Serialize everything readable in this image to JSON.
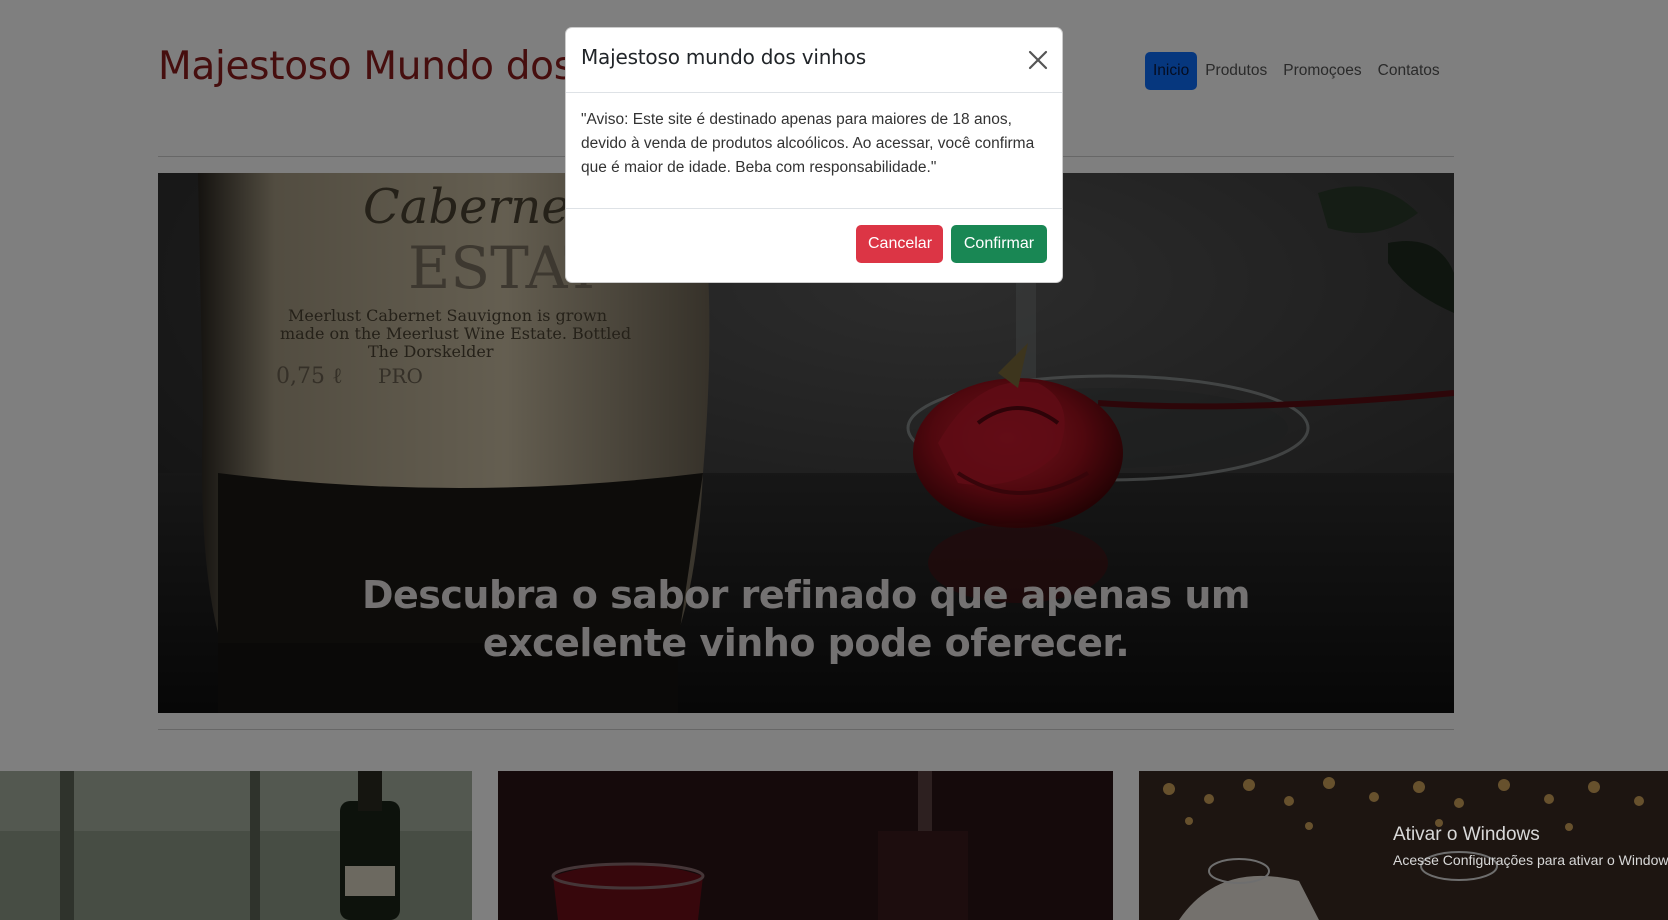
{
  "site": {
    "title": "Majestoso Mundo dos",
    "nav": [
      {
        "label": "Inicio",
        "active": true
      },
      {
        "label": "Produtos",
        "active": false
      },
      {
        "label": "Promoçoes",
        "active": false
      },
      {
        "label": "Contatos",
        "active": false
      }
    ]
  },
  "hero": {
    "caption_line1": "Descubra o sabor refinado que apenas um",
    "caption_line2": "excelente vinho pode oferecer.",
    "label_texts": [
      "Cabernet",
      "ESTAT",
      "Meerlust Cabernet Sauvignon is grown",
      "made on the Meerlust Wine Estate. Bottled",
      "The Dorskelder",
      "0,75 ℓ",
      "PRO"
    ]
  },
  "modal": {
    "title": "Majestoso mundo dos vinhos",
    "body": "\"Aviso: Este site é destinado apenas para maiores de 18 anos, devido à venda de produtos alcoólicos. Ao acessar, você confirma que é maior de idade. Beba com responsabilidade.\"",
    "cancel_label": "Cancelar",
    "confirm_label": "Confirmar"
  },
  "watermark": {
    "line1": "Ativar o Windows",
    "line2": "Acesse Configurações para ativar o Windows."
  },
  "colors": {
    "title_red": "#8c1c1c",
    "nav_active": "#0d6efd",
    "cancel": "#dc3545",
    "confirm": "#198754"
  }
}
